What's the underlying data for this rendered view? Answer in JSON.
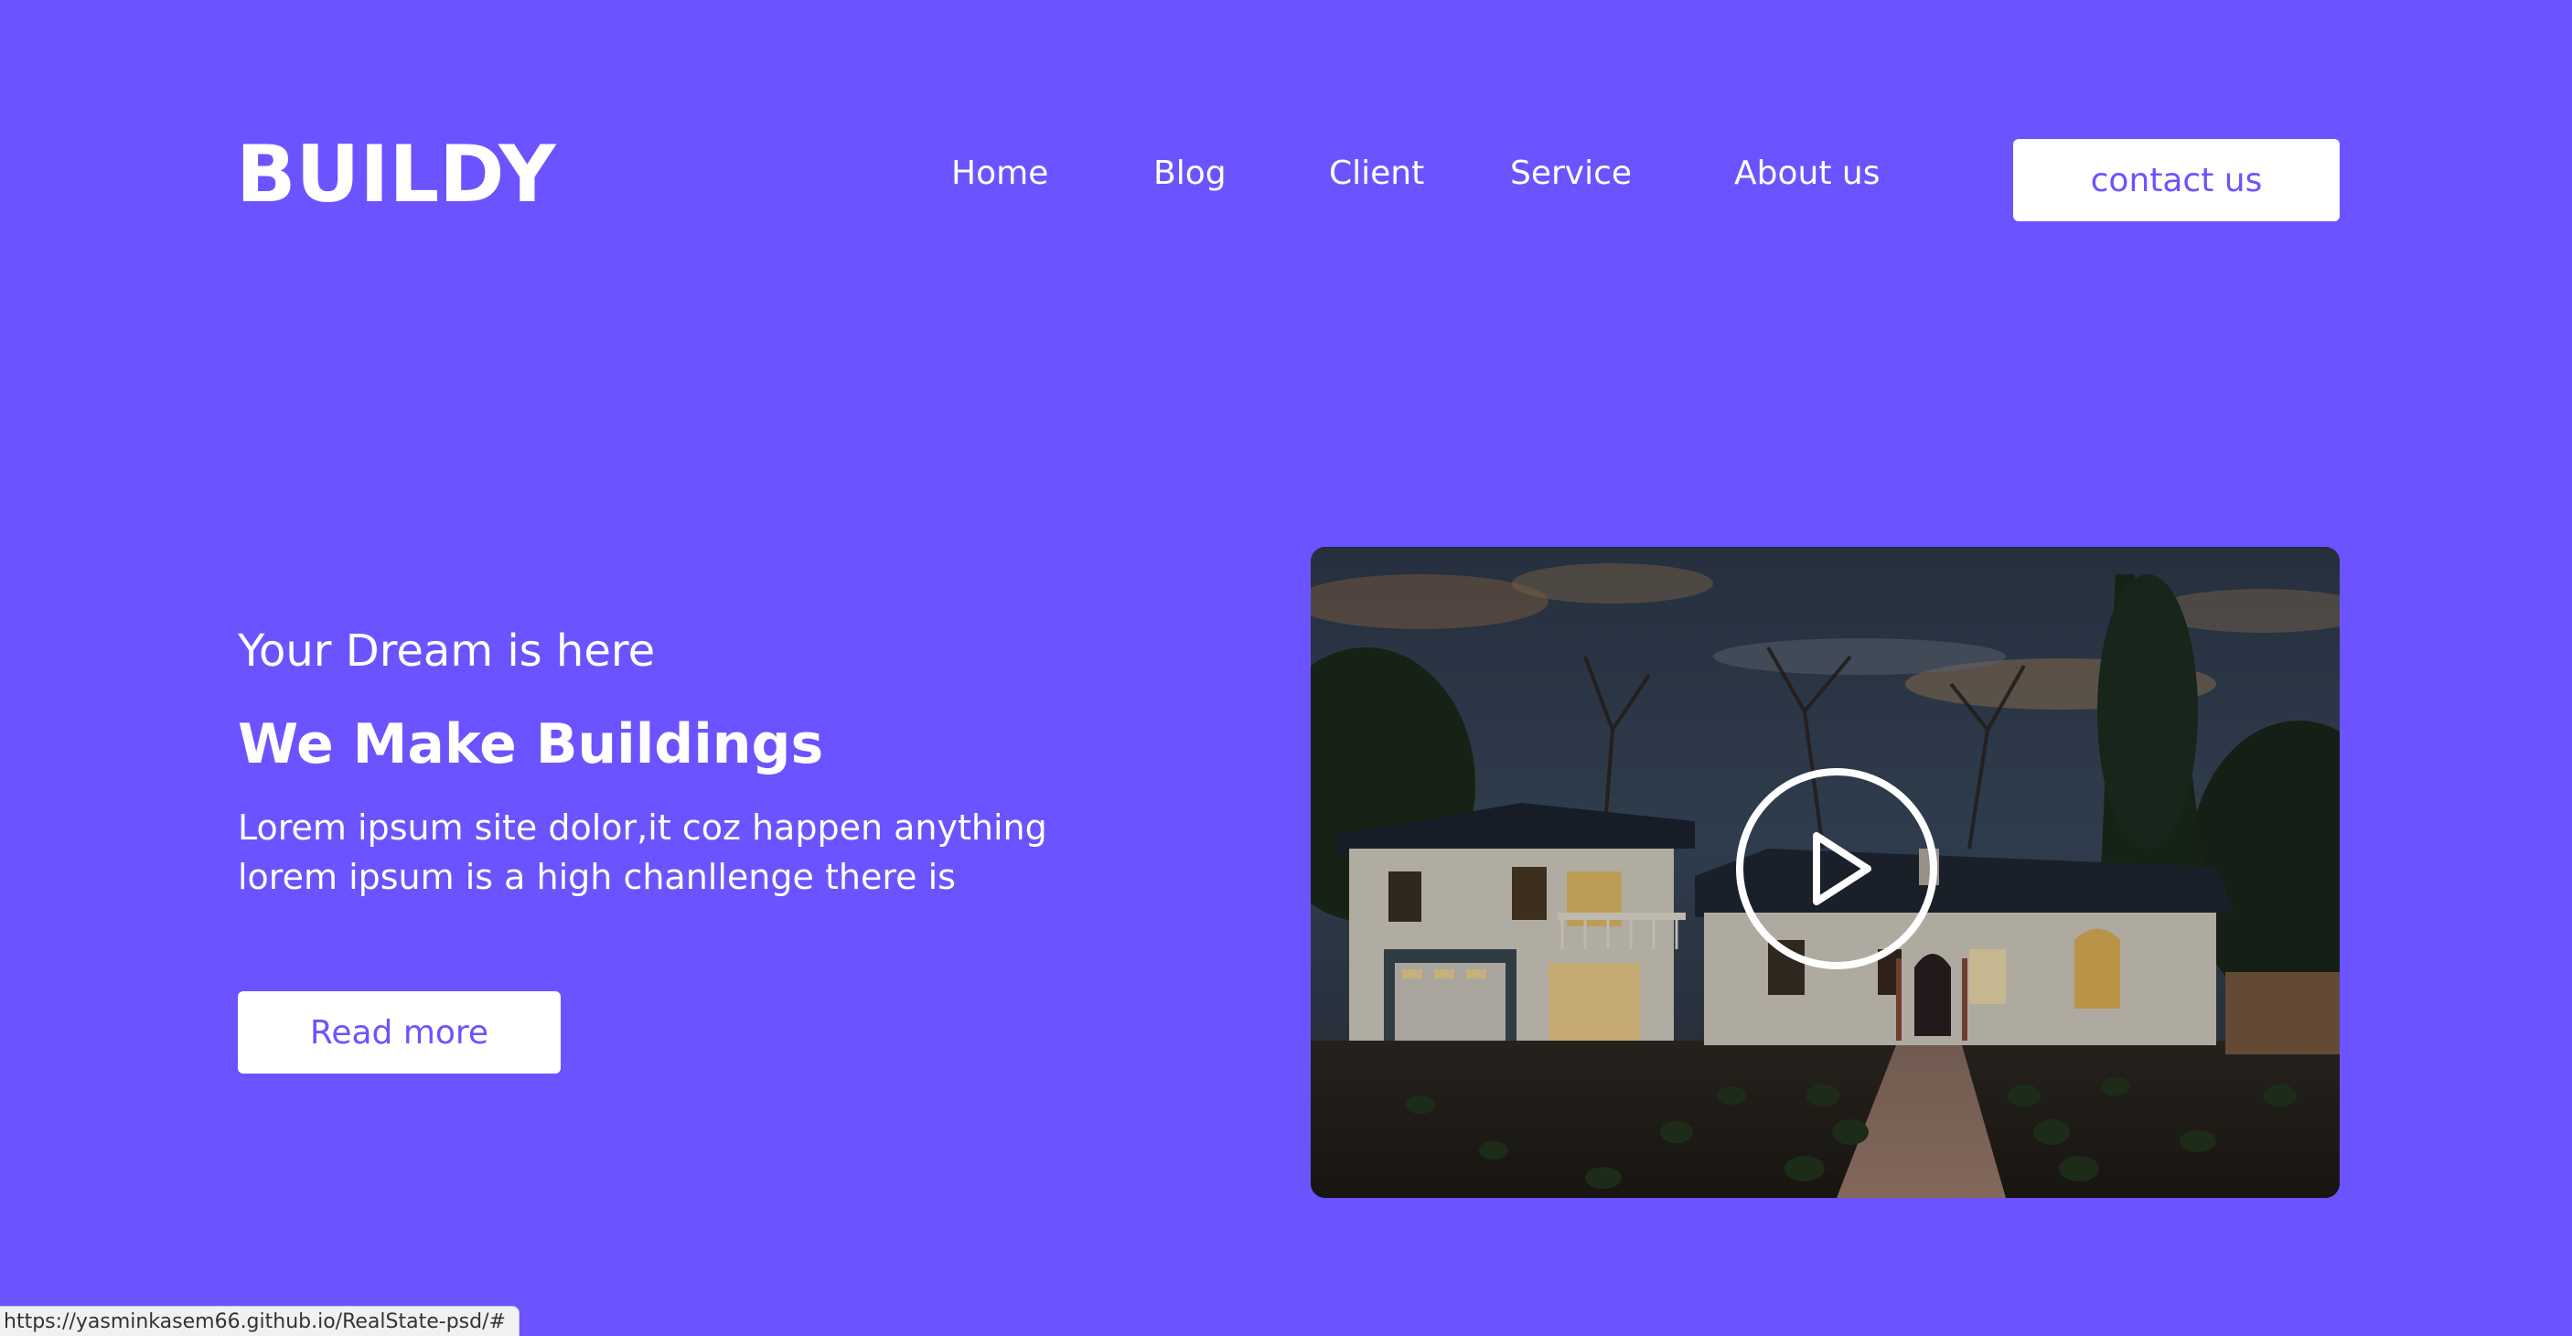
{
  "brand": {
    "logo_text": "BUILDY"
  },
  "nav": {
    "items": [
      "Home",
      "Blog",
      "Client",
      "Service",
      "About us"
    ],
    "contact_label": "contact us"
  },
  "hero": {
    "subtitle": "Your Dream is here",
    "title": "We Make Buildings",
    "body": "Lorem ipsum site dolor,it coz happen anything lorem ipsum is a high chanllenge there is",
    "read_more_label": "Read more"
  },
  "video": {
    "play_icon": "play-icon"
  },
  "status": {
    "url": "https://yasminkasem66.github.io/RealState-psd/#"
  },
  "colors": {
    "background": "#6b54ff",
    "button_bg": "#ffffff",
    "button_text": "#6b54ff"
  }
}
